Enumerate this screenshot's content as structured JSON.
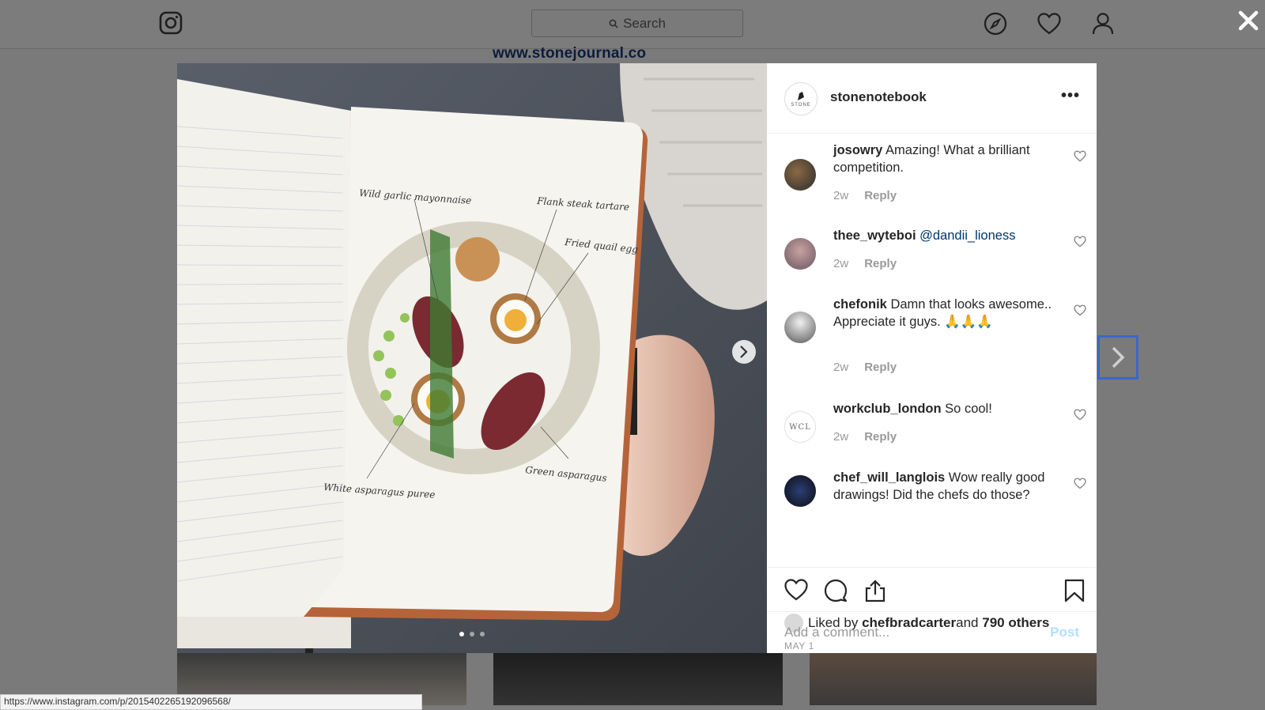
{
  "nav": {
    "search_placeholder": "Search"
  },
  "watermark": "www.stonejournal.co",
  "post": {
    "username": "stonenotebook",
    "avatar_text": "STONE",
    "more_label": "•••",
    "image_labels": [
      "Wild garlic mayonnaise",
      "Flank steak tartare",
      "Fried quail egg",
      "Green asparagus",
      "White asparagus puree"
    ],
    "carousel_dots": 3,
    "carousel_active": 0
  },
  "comments": [
    {
      "user": "josowry",
      "text": " Amazing! What a brilliant competition.",
      "age": "2w",
      "reply": "Reply"
    },
    {
      "user": "thee_wyteboi",
      "text": " ",
      "mention": "@dandii_lioness",
      "age": "2w",
      "reply": "Reply"
    },
    {
      "user": "chefonik",
      "text": " Damn that looks awesome.. Appreciate it guys. 🙏🙏🙏",
      "age": "2w",
      "reply": "Reply"
    },
    {
      "user": "workclub_london",
      "text": " So cool!",
      "age": "2w",
      "reply": "Reply",
      "avatar_text": "WCL"
    },
    {
      "user": "chef_will_langlois",
      "text": " Wow really good drawings! Did the chefs do those?",
      "age": "2w",
      "reply": "Reply"
    }
  ],
  "likes": {
    "prefix": "Liked by ",
    "user": "chefbradcarter",
    "middle": " and ",
    "count": "790 others"
  },
  "date": "MAY 1",
  "add_comment": {
    "placeholder": "Add a comment...",
    "post_label": "Post"
  },
  "status_url": "https://www.instagram.com/p/2015402265192096568/"
}
